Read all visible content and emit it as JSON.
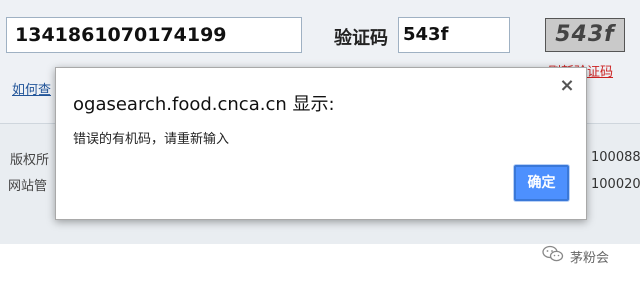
{
  "form": {
    "code_value": "1341861070174199",
    "captcha_label": "验证码",
    "captcha_value": "543f",
    "captcha_image_text": "543f",
    "refresh_link": "刷新验证码",
    "howto_link": "如何查"
  },
  "footer": {
    "copyright_line": "版权所",
    "website_line": "网站管",
    "postcode_1": "100088",
    "postcode_2": "100020"
  },
  "dialog": {
    "title": "ogasearch.food.cnca.cn 显示:",
    "message": "错误的有机码，请重新输入",
    "ok_label": "确定",
    "close_glyph": "×"
  },
  "watermark": {
    "text": "茅粉会"
  },
  "colors": {
    "ok_button": "#4d90fe",
    "link_blue": "#225599",
    "link_red": "#cc2222"
  }
}
